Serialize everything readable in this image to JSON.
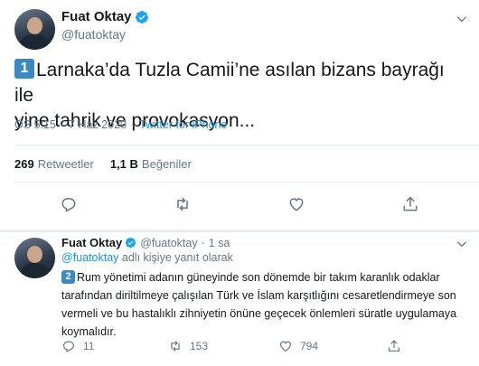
{
  "main_tweet": {
    "display_name": "Fuat Oktay",
    "handle": "@fuatoktay",
    "keycap": "1",
    "text_line1": "Larnaka’da Tuzla Camii’ne asılan bizans bayrağı ile",
    "text_line2": "yine tahrik ve provokasyon...",
    "time": "ÖS 5:15",
    "date": "7 Haz 2020",
    "source": "Twitter for iPhone",
    "retweets_count": "269",
    "retweets_label": "Retweetler",
    "likes_count": "1,1 B",
    "likes_label": "Beğeniler",
    "icons": [
      "verified-badge-icon",
      "chevron-down-icon",
      "reply-icon",
      "retweet-icon",
      "heart-icon",
      "share-icon"
    ]
  },
  "reply_tweet": {
    "display_name": "Fuat Oktay",
    "handle": "@fuatoktay",
    "separator": "·",
    "time": "1 sa",
    "replying_mention": "@fuatoktay",
    "replying_suffix": " adlı kişiye yanıt olarak",
    "keycap": "2",
    "text_line1": "Rum yönetimi adanın güneyinde son dönemde bir takım karanlık odaklar",
    "text_line2": "tarafından diriltilmeye çalışılan Türk ve İslam karşıtlığını cesaretlendirmeye son",
    "text_line3": "vermeli ve bu hastalıklı zihniyetin önüne geçecek önlemleri süratle uygulamaya",
    "text_line4": "koymalıdır.",
    "replies": "11",
    "retweets": "153",
    "likes": "794"
  },
  "colors": {
    "accent": "#1b95e0",
    "text": "#14171a",
    "muted": "#657786",
    "divider": "#e6ecf0",
    "keycap": "#3b88c3"
  }
}
